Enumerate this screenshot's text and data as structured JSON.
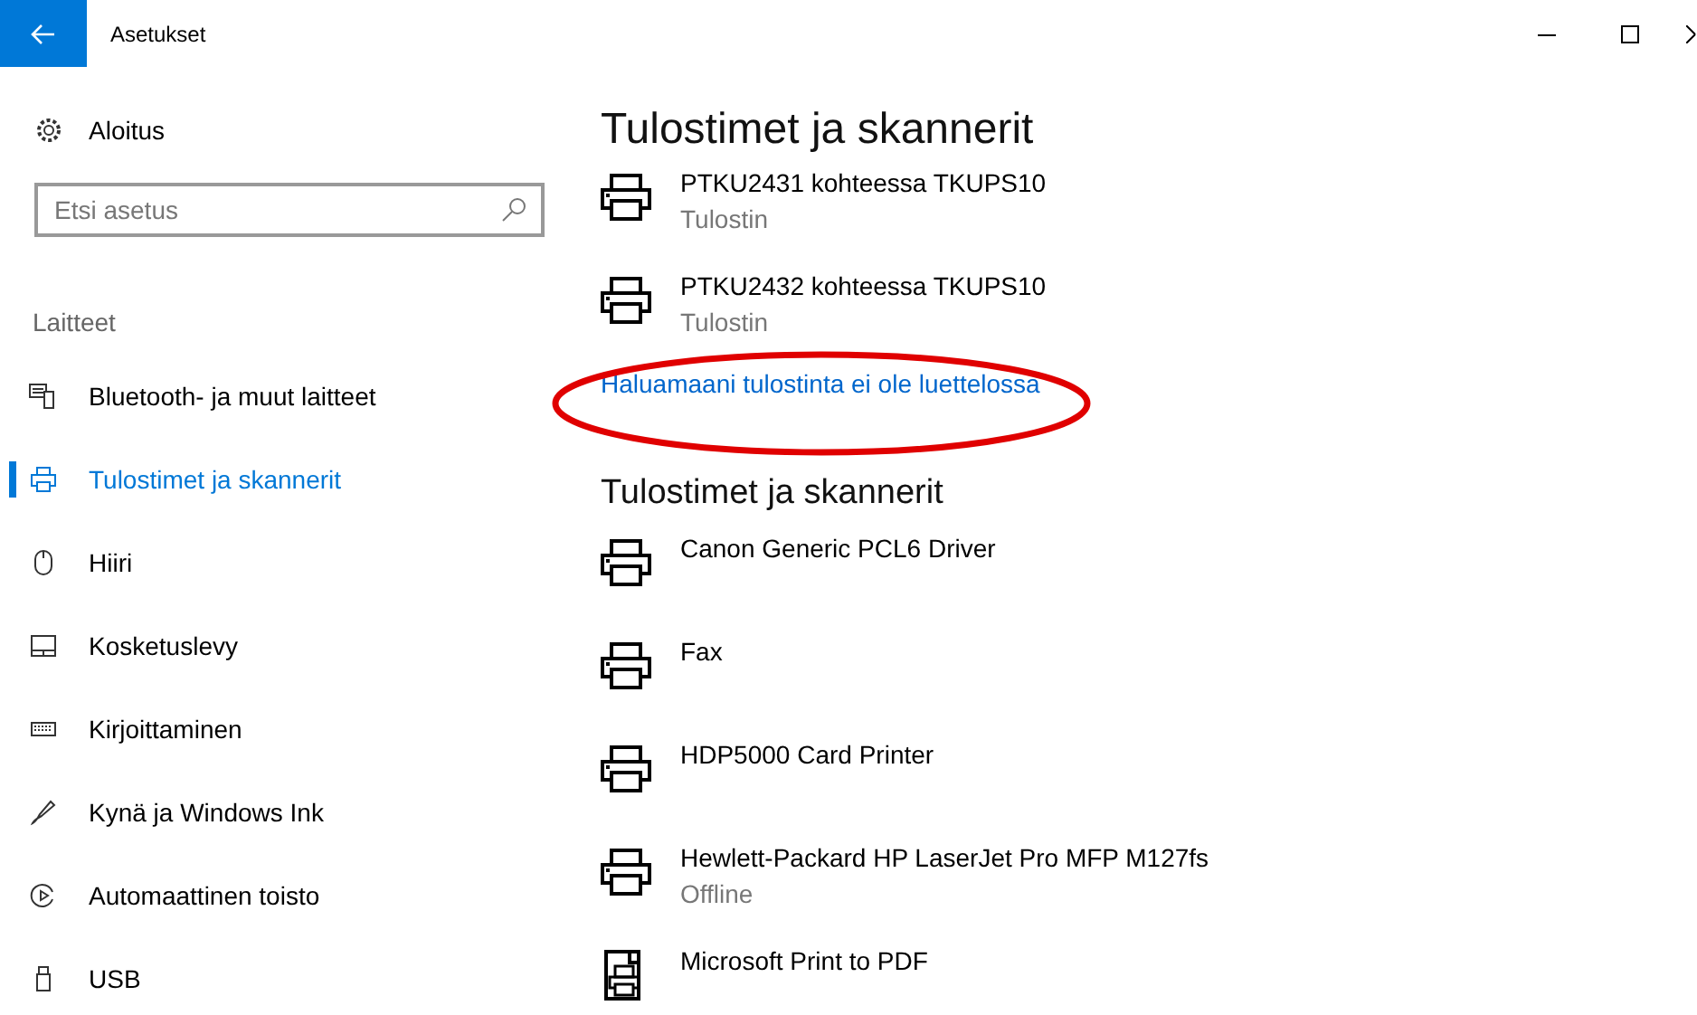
{
  "window": {
    "title": "Asetukset"
  },
  "sidebar": {
    "home": "Aloitus",
    "search": {
      "placeholder": "Etsi asetus"
    },
    "section": "Laitteet",
    "items": [
      {
        "label": "Bluetooth- ja muut laitteet",
        "selected": false
      },
      {
        "label": "Tulostimet ja skannerit",
        "selected": true
      },
      {
        "label": "Hiiri",
        "selected": false
      },
      {
        "label": "Kosketuslevy",
        "selected": false
      },
      {
        "label": "Kirjoittaminen",
        "selected": false
      },
      {
        "label": "Kynä ja Windows Ink",
        "selected": false
      },
      {
        "label": "Automaattinen toisto",
        "selected": false
      },
      {
        "label": "USB",
        "selected": false
      }
    ]
  },
  "main": {
    "heading": "Tulostimet ja skannerit",
    "printers": [
      {
        "kind": "printer",
        "name": "PTKU2431 kohteessa TKUPS10",
        "status": "Tulostin"
      },
      {
        "kind": "printer",
        "name": "PTKU2432 kohteessa TKUPS10",
        "status": "Tulostin"
      }
    ],
    "link": "Haluamaani tulostinta ei ole luettelossa",
    "section_heading": "Tulostimet ja skannerit",
    "devices": [
      {
        "kind": "printer",
        "name": "Canon Generic PCL6 Driver"
      },
      {
        "kind": "printer",
        "name": "Fax"
      },
      {
        "kind": "printer",
        "name": "HDP5000 Card Printer"
      },
      {
        "kind": "printer",
        "name": "Hewlett-Packard HP LaserJet Pro MFP M127fs",
        "status": "Offline"
      },
      {
        "kind": "document-printer",
        "name": "Microsoft Print to PDF"
      }
    ]
  }
}
